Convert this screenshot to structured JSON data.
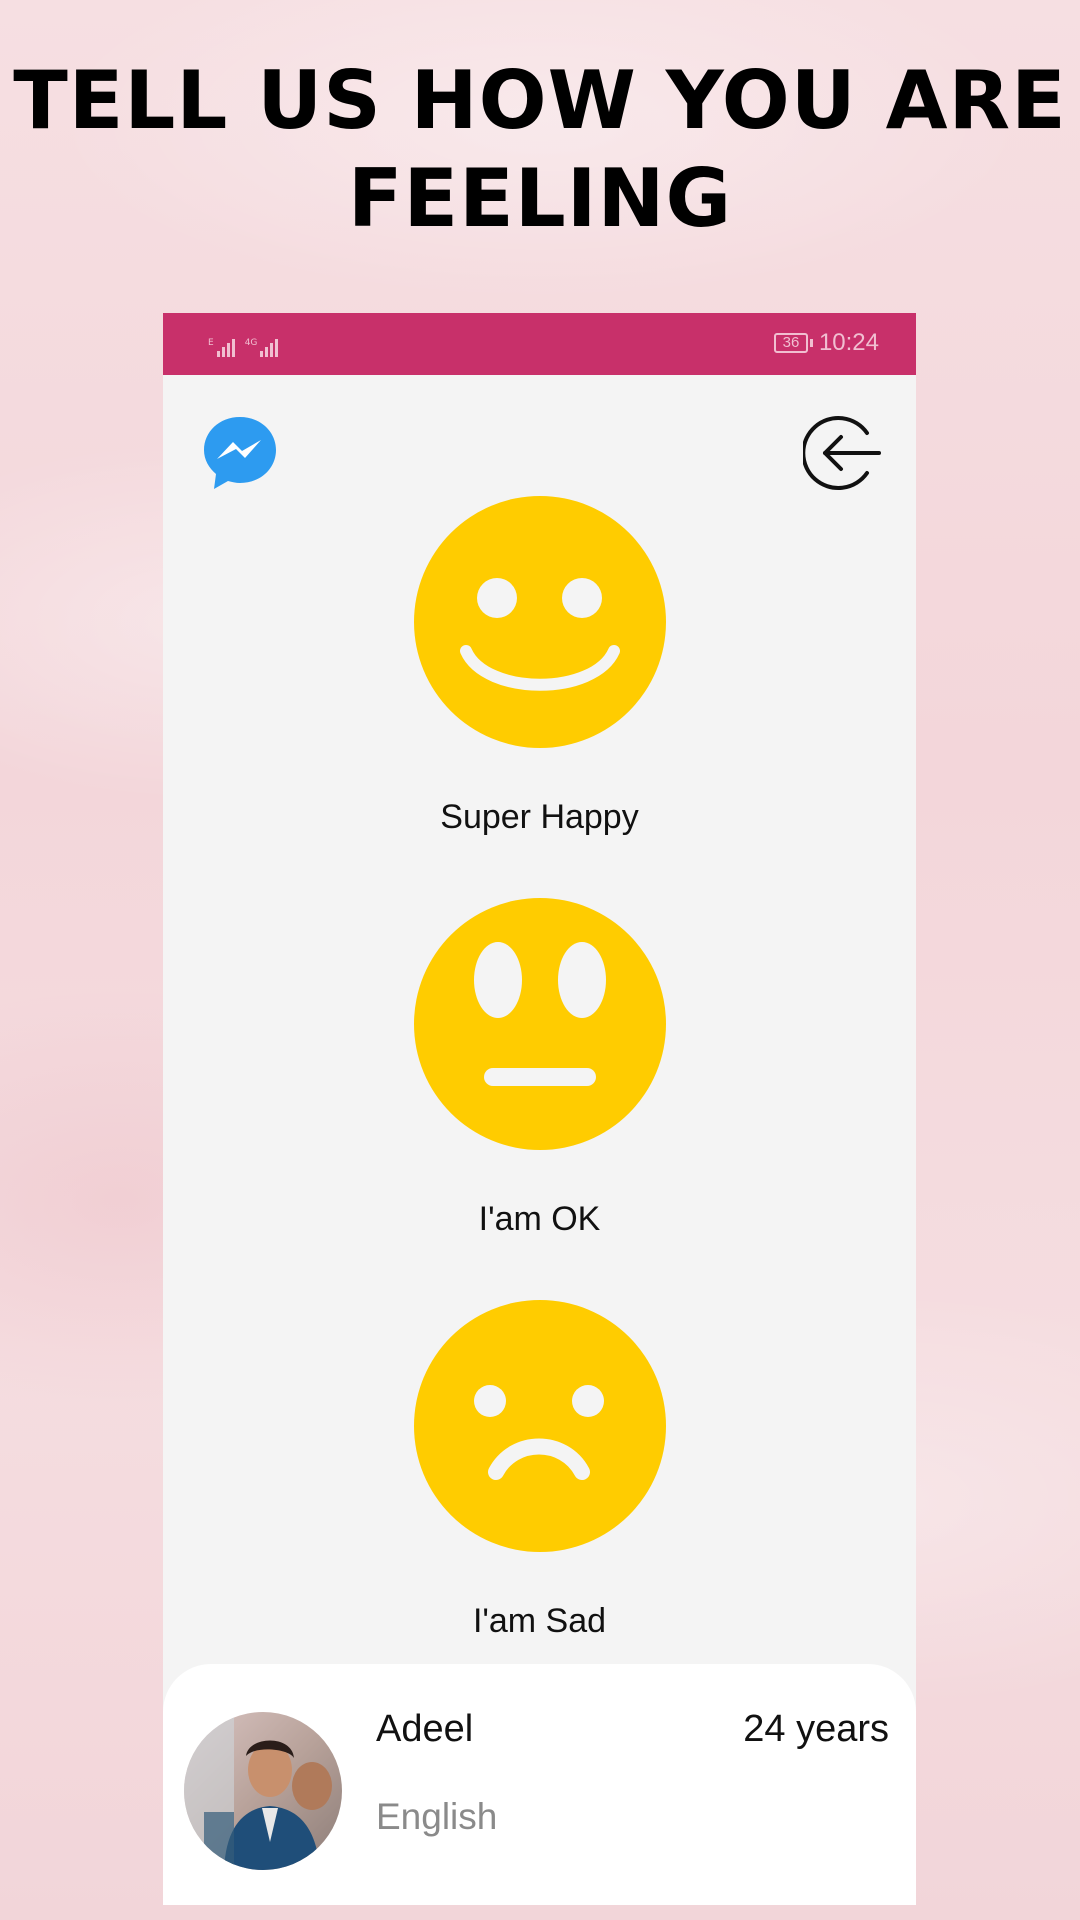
{
  "headline": "TELL US HOW YOU ARE FEELING",
  "status_bar": {
    "network_1": "E",
    "network_2": "4G",
    "battery": "36",
    "time": "10:24",
    "color": "#c8306a"
  },
  "toolbar": {
    "left_icon": "messenger-icon",
    "right_icon": "logout-icon"
  },
  "moods": [
    {
      "label": "Super Happy",
      "icon": "happy-face-icon"
    },
    {
      "label": "I'am OK",
      "icon": "neutral-face-icon"
    },
    {
      "label": "I'am Sad",
      "icon": "sad-face-icon"
    }
  ],
  "profile": {
    "name": "Adeel",
    "age": "24 years",
    "language": "English",
    "avatar_icon": "avatar"
  },
  "colors": {
    "face": "#ffcc00",
    "messenger": "#2d9bf0",
    "accent": "#c8306a"
  }
}
